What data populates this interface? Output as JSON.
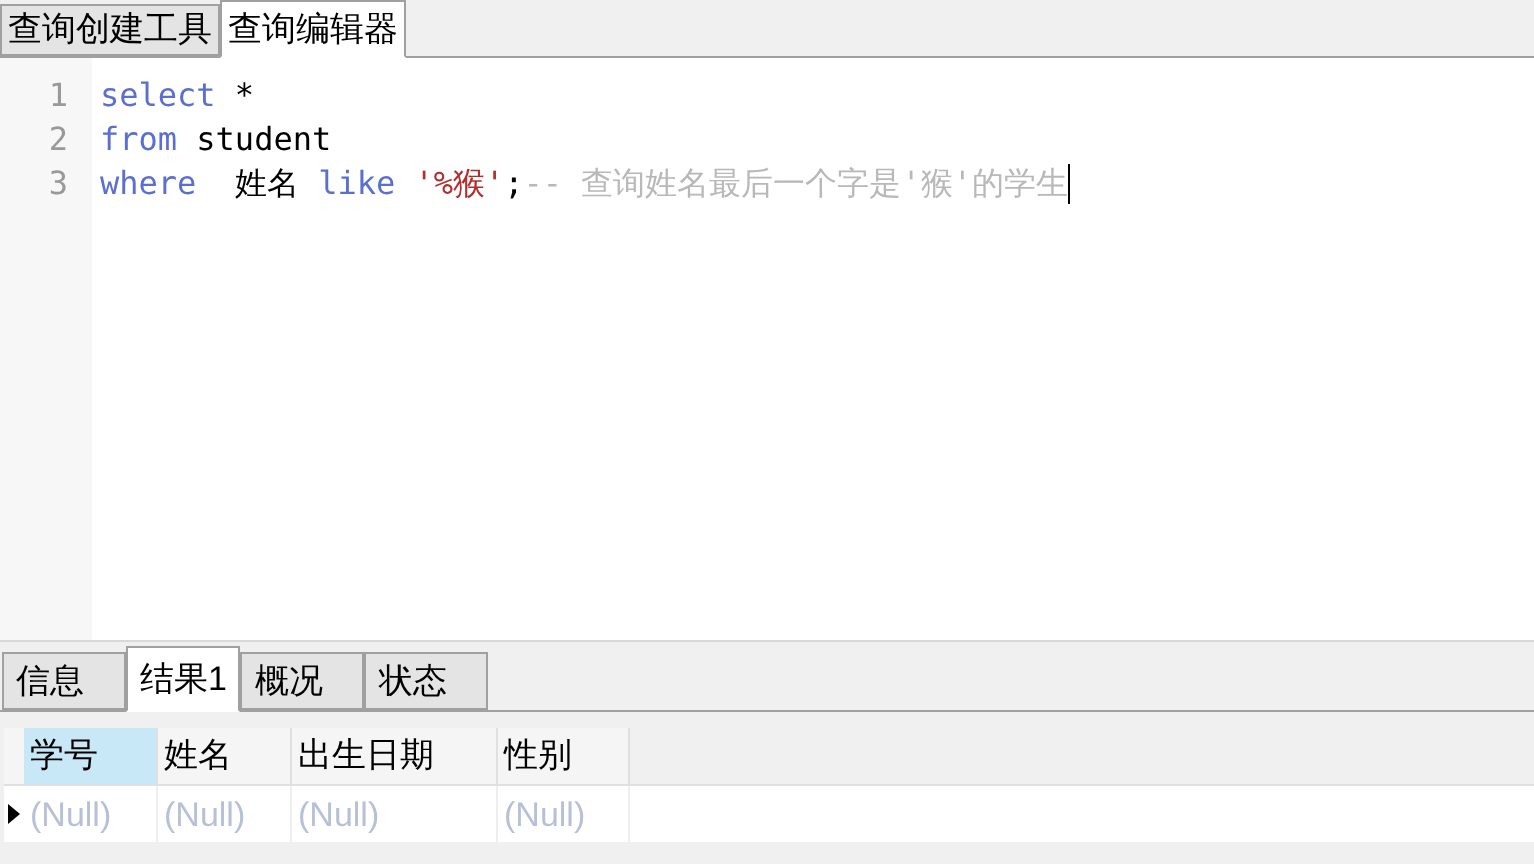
{
  "editor_tabs": [
    {
      "label": "查询创建工具",
      "selected": false
    },
    {
      "label": "查询编辑器",
      "selected": true
    }
  ],
  "code_lines": [
    {
      "number": "1",
      "tokens": [
        {
          "kind": "keyword",
          "text": "select"
        },
        {
          "kind": "plain",
          "text": " *"
        }
      ]
    },
    {
      "number": "2",
      "tokens": [
        {
          "kind": "keyword",
          "text": "from"
        },
        {
          "kind": "plain",
          "text": " student"
        }
      ]
    },
    {
      "number": "3",
      "tokens": [
        {
          "kind": "keyword",
          "text": "where"
        },
        {
          "kind": "plain",
          "text": "  姓名 "
        },
        {
          "kind": "keyword",
          "text": "like "
        },
        {
          "kind": "string",
          "text": "'%猴'"
        },
        {
          "kind": "plain",
          "text": ";"
        },
        {
          "kind": "comment",
          "text": "-- 查询姓名最后一个字是'猴'的学生"
        }
      ]
    }
  ],
  "result_tabs": [
    {
      "label": "信息",
      "selected": false
    },
    {
      "label": "结果1",
      "selected": true
    },
    {
      "label": "概况",
      "selected": false
    },
    {
      "label": "状态",
      "selected": false
    }
  ],
  "table": {
    "columns": [
      {
        "label": "学号",
        "selected": true
      },
      {
        "label": "姓名",
        "selected": false
      },
      {
        "label": "出生日期",
        "selected": false
      },
      {
        "label": "性别",
        "selected": false
      }
    ],
    "rows": [
      {
        "current": true,
        "cells": [
          "(Null)",
          "(Null)",
          "(Null)",
          "(Null)"
        ]
      }
    ]
  }
}
